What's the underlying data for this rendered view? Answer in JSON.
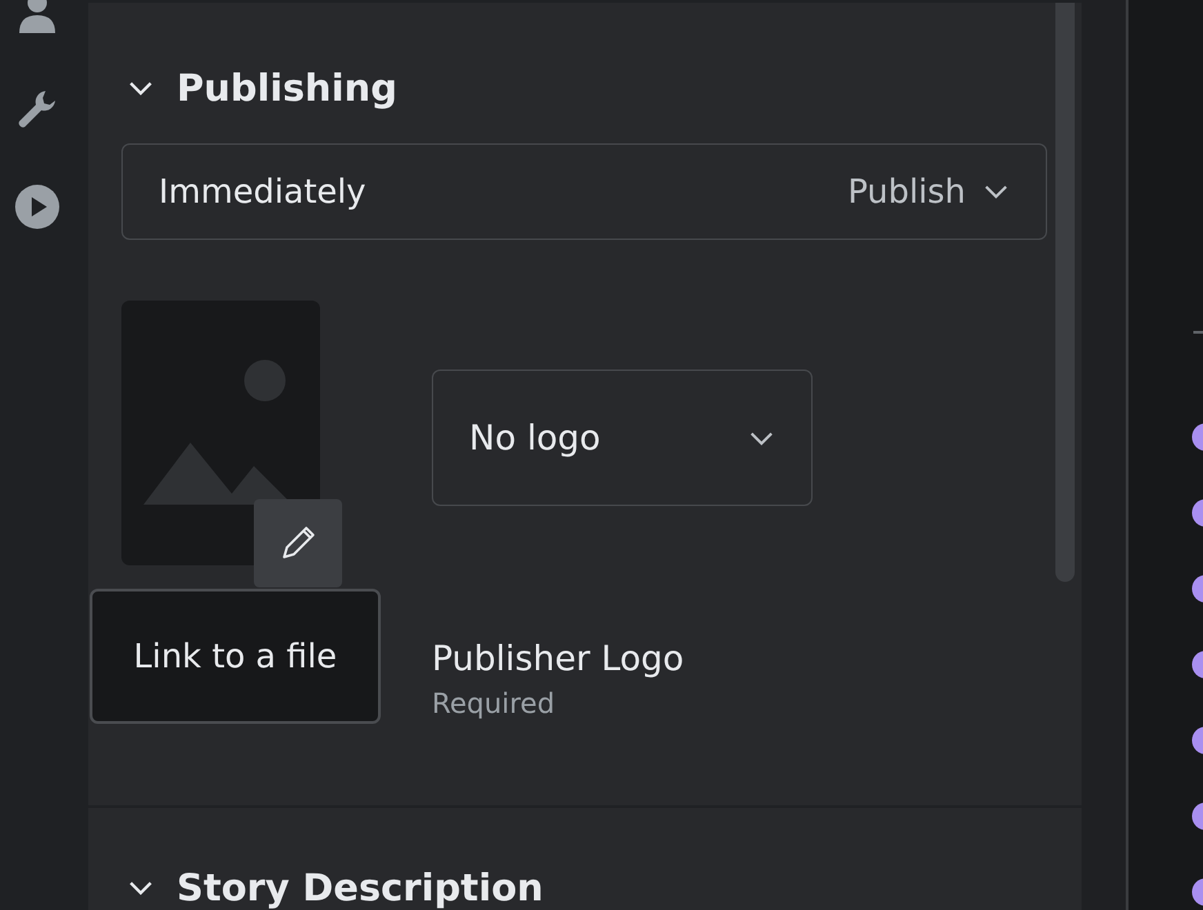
{
  "sidebar": {
    "items": [
      {
        "kind": "person"
      },
      {
        "kind": "wrench"
      },
      {
        "kind": "play"
      }
    ]
  },
  "publishing": {
    "title": "Publishing",
    "expanded": true,
    "timing": {
      "value": "Immediately",
      "action": "Publish"
    },
    "tooltip": "Link to a file",
    "logo_select": {
      "value": "No logo"
    },
    "logo_label": "Publisher Logo",
    "logo_hint": "Required"
  },
  "next_section": {
    "title": "Story Description",
    "expanded": true
  },
  "checklist": {
    "bullets": [
      {
        "color": "#a98ff0"
      },
      {
        "color": "#a98ff0"
      },
      {
        "color": "#a98ff0"
      },
      {
        "color": "#a98ff0"
      },
      {
        "color": "#a98ff0"
      },
      {
        "color": "#a98ff0"
      },
      {
        "color": "#a98ff0"
      }
    ]
  }
}
